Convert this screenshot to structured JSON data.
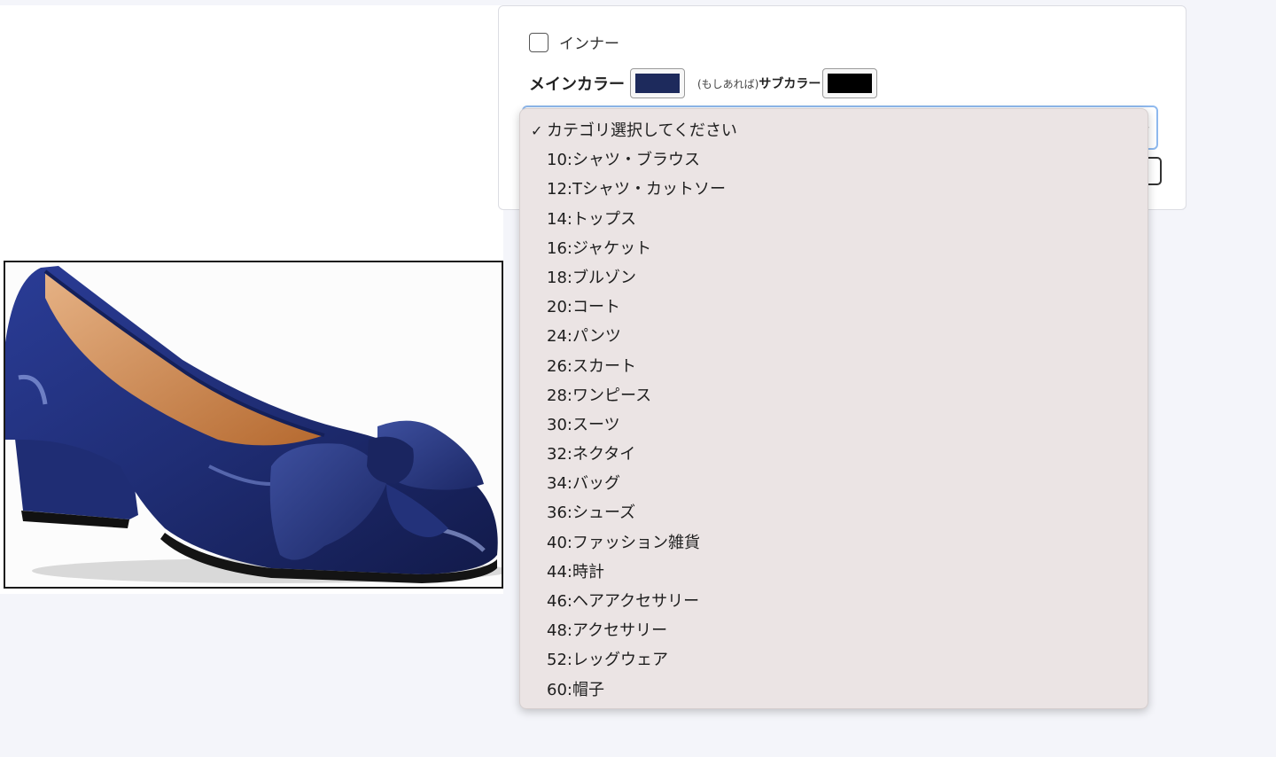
{
  "form": {
    "inner_label": "インナー",
    "inner_checked": false,
    "main_color_label": "メインカラー",
    "main_color": "#1d2a5c",
    "sub_color_note": "(もしあれば)",
    "sub_color_label": "サブカラー",
    "sub_color": "#000000"
  },
  "category_select": {
    "selected": "カテゴリ選択してください",
    "options": [
      "カテゴリ選択してください",
      "10:シャツ・ブラウス",
      "12:Tシャツ・カットソー",
      "14:トップス",
      "16:ジャケット",
      "18:ブルゾン",
      "20:コート",
      "24:パンツ",
      "26:スカート",
      "28:ワンピース",
      "30:スーツ",
      "32:ネクタイ",
      "34:バッグ",
      "36:シューズ",
      "40:ファッション雑貨",
      "44:時計",
      "46:ヘアアクセサリー",
      "48:アクセサリー",
      "52:レッグウェア",
      "60:帽子"
    ]
  },
  "colors": {
    "page_bg": "#f4f5fa",
    "dropdown_bg": "#ebe4e4",
    "focus_border": "#8fb9ee",
    "shoe_navy": "#1f2d74"
  }
}
